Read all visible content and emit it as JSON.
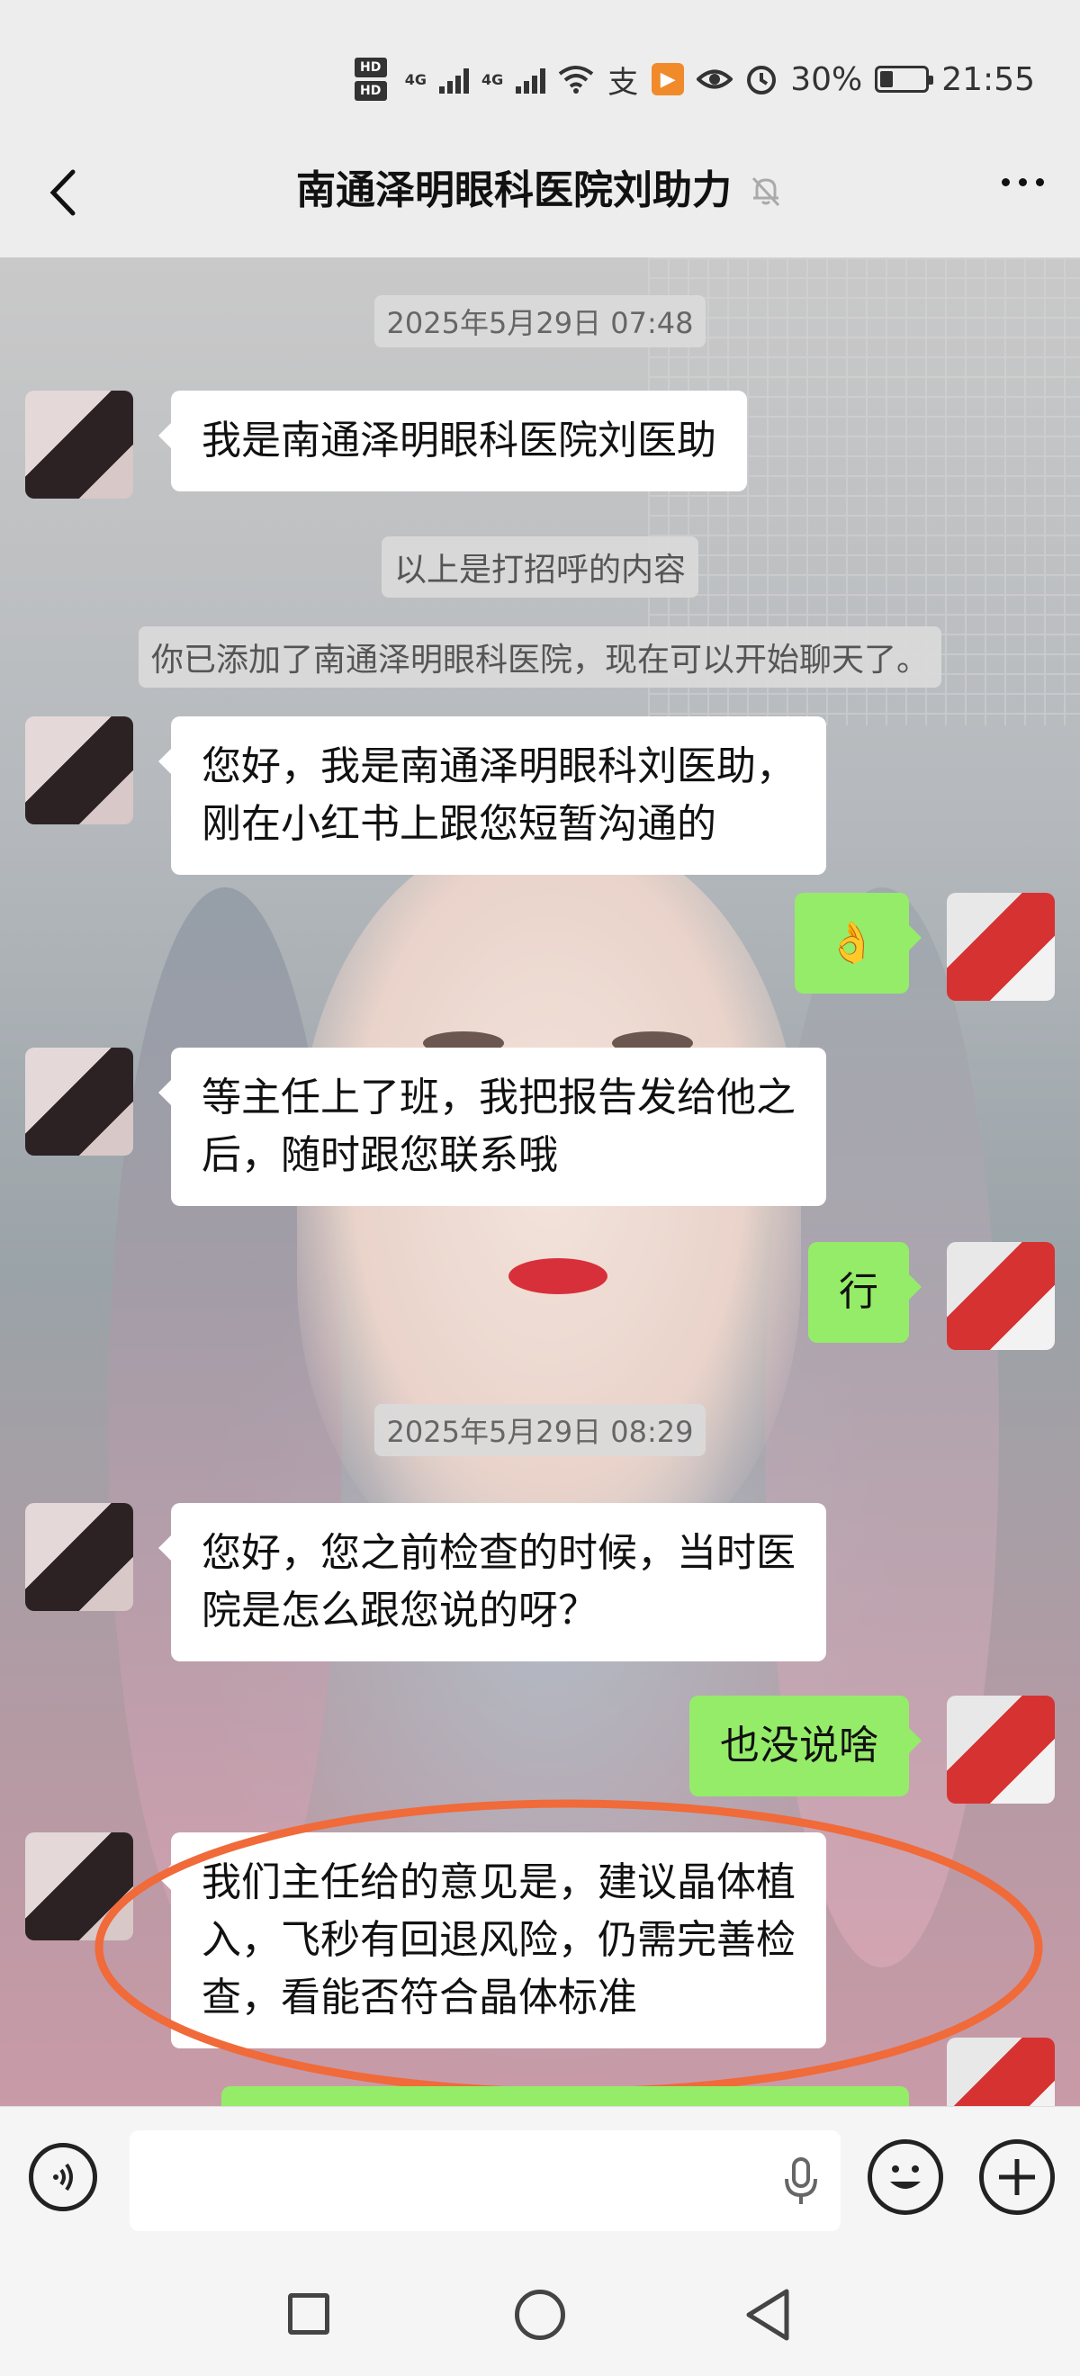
{
  "status_bar": {
    "hd1": "HD",
    "hd2": "HD",
    "net1": "4G",
    "net2": "4G",
    "pay_glyph": "支",
    "battery_percent": "30%",
    "time": "21:55",
    "battery_level": 0.3,
    "icons": [
      "hd-icon",
      "signal-icon",
      "wifi-icon",
      "alipay-icon",
      "video-icon",
      "eye-icon",
      "alarm-icon",
      "battery-icon"
    ]
  },
  "header": {
    "title": "南通泽明眼科医院刘助力",
    "icons": [
      "back-icon",
      "mute-bell-icon",
      "more-icon"
    ]
  },
  "chat": {
    "timestamp1": "2025年5月29日 07:48",
    "msg1": "我是南通泽明眼科医院刘医助",
    "sys1": "以上是打招呼的内容",
    "sys2": "你已添加了南通泽明眼科医院，现在可以开始聊天了。",
    "msg2_line1": "您好，我是南通泽明眼科刘医助，",
    "msg2_line2": "刚在小红书上跟您短暂沟通的",
    "msg3": "👌",
    "msg4_line1": "等主任上了班，我把报告发给他之",
    "msg4_line2": "后，随时跟您联系哦",
    "msg5": "行",
    "timestamp2": "2025年5月29日 08:29",
    "msg6_line1": "您好，您之前检查的时候，当时医",
    "msg6_line2": "院是怎么跟您说的呀？",
    "msg7": "也没说啥",
    "msg8_line1": "我们主任给的意见是，建议晶体植",
    "msg8_line2": "入，飞秒有回退风险，仍需完善检",
    "msg8_line3": "查，看能否符合晶体标准",
    "annotation_color": "#f06a3a"
  },
  "input_bar": {
    "icons": [
      "voice-icon",
      "microphone-icon",
      "emoji-icon",
      "plus-icon"
    ]
  },
  "nav_bar": {
    "icons": [
      "recent-apps-icon",
      "home-icon",
      "back-nav-icon"
    ]
  },
  "colors": {
    "outgoing_bubble": "#95ec69",
    "incoming_bubble": "#ffffff",
    "background": "#ededed"
  }
}
